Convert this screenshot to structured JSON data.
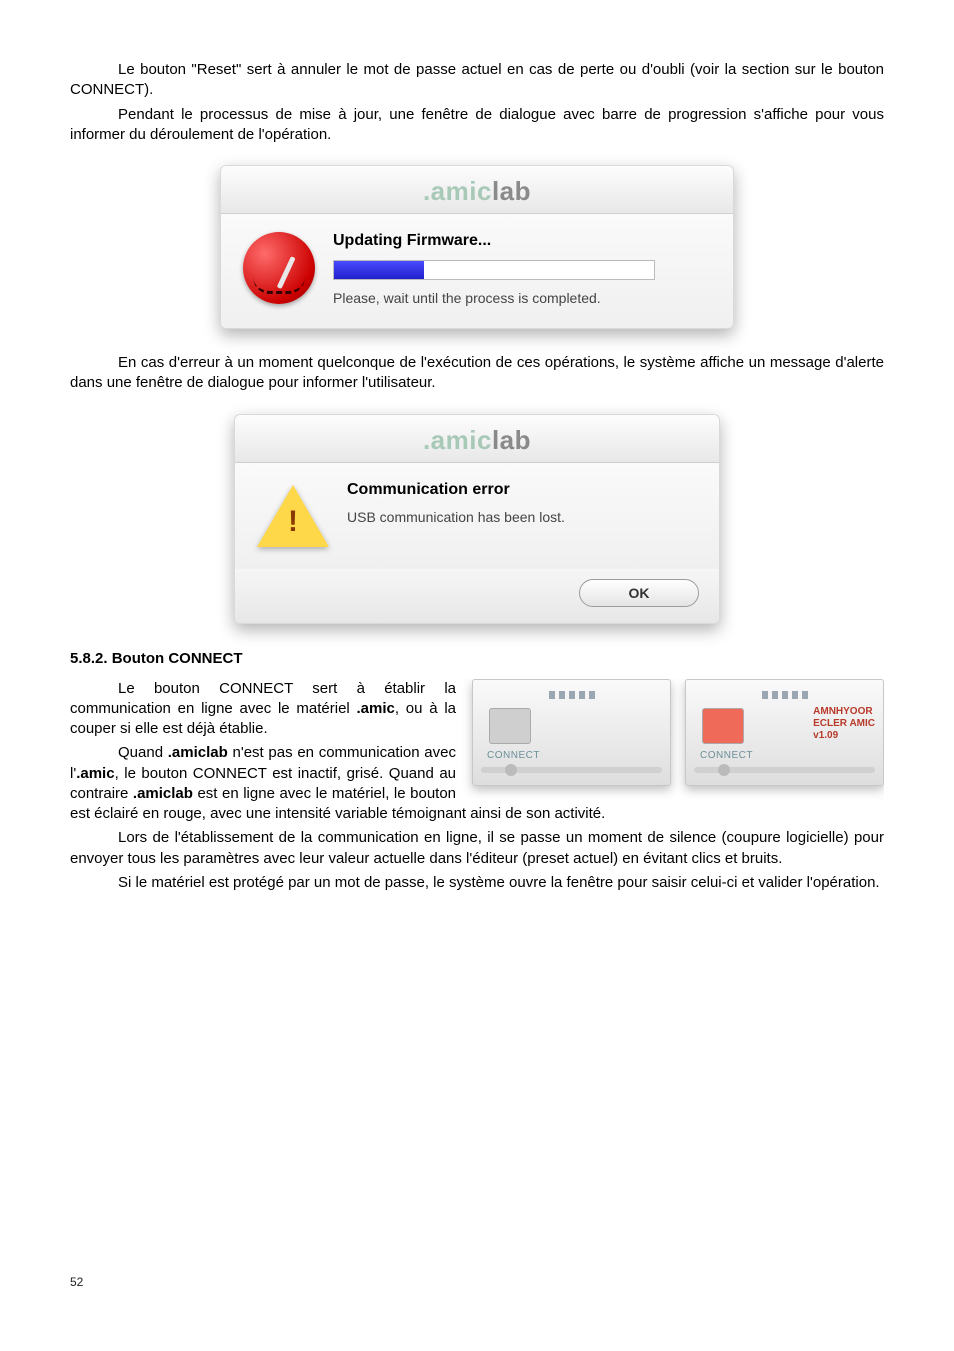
{
  "paragraphs": {
    "p1a": "Le bouton \"Reset\" sert à annuler le mot de passe actuel en cas de perte ou d'oubli (voir la section sur le bouton CONNECT).",
    "p1b": "Pendant le processus de mise à jour, une fenêtre de dialogue avec barre de progression s'affiche pour vous informer du déroulement de l'opération.",
    "p2": "En cas d'erreur à un moment quelconque de l'exécution de ces opérations, le système affiche un message d'alerte dans une fenêtre de dialogue pour informer l'utilisateur.",
    "sec_heading": "5.8.2. Bouton CONNECT",
    "c1_a": "Le bouton CONNECT sert à établir la communication en ligne avec le matériel ",
    "c1_b": ".amic",
    "c1_c": ", ou à la couper si elle est déjà établie.",
    "c2_a": "Quand ",
    "c2_b": ".amiclab",
    "c2_c": " n'est pas en communication avec l'",
    "c2_d": ".amic",
    "c2_e": ", le bouton CONNECT est inactif, grisé. Quand au contraire ",
    "c2_f": ".amiclab",
    "c2_g": " est en ligne avec le matériel, le bouton est éclairé en rouge, avec une intensité variable témoignant ainsi de son activité.",
    "c3": "Lors de l'établissement de la communication en ligne, il se passe un moment de silence (coupure logicielle) pour envoyer tous les paramètres avec leur valeur actuelle dans l'éditeur (preset actuel) en évitant clics et bruits.",
    "c4": "Si le matériel est protégé par un mot de passe, le système ouvre la fenêtre pour saisir celui-ci et valider l'opération."
  },
  "brand": {
    "amic": ".amic",
    "lab": "lab"
  },
  "dialog_firmware": {
    "title": "Updating Firmware...",
    "msg": "Please, wait until the process is completed.",
    "progress_pct": 28
  },
  "dialog_error": {
    "title": "Communication error",
    "msg": "USB communication has been lost.",
    "ok": "OK"
  },
  "connect": {
    "label": "CONNECT",
    "device_name": "AMNHYOOR",
    "device_model": "ECLER AMIC",
    "device_version": "v1.09"
  },
  "page_number": "52"
}
